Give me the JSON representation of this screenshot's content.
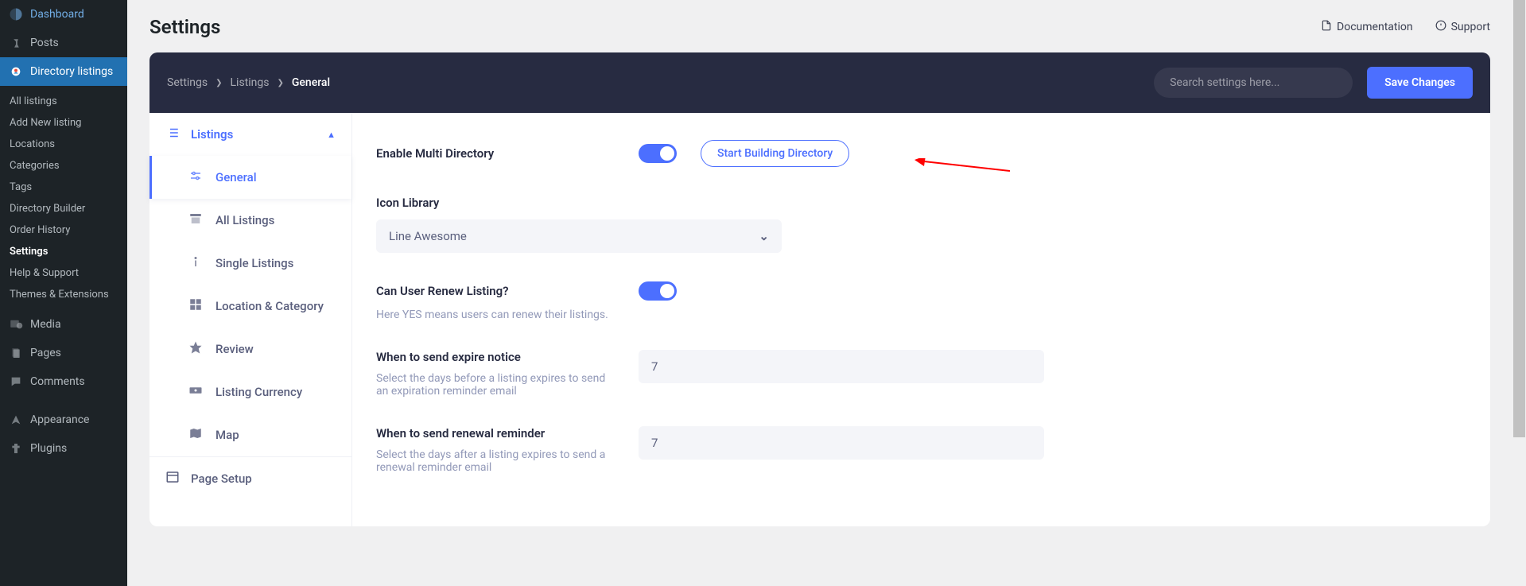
{
  "wp_sidebar": {
    "dashboard": "Dashboard",
    "posts": "Posts",
    "directory_listings": "Directory listings",
    "submenu": {
      "all_listings": "All listings",
      "add_new": "Add New listing",
      "locations": "Locations",
      "categories": "Categories",
      "tags": "Tags",
      "directory_builder": "Directory Builder",
      "order_history": "Order History",
      "settings": "Settings",
      "help_support": "Help & Support",
      "themes_ext": "Themes & Extensions"
    },
    "media": "Media",
    "pages": "Pages",
    "comments": "Comments",
    "appearance": "Appearance",
    "plugins": "Plugins"
  },
  "header": {
    "title": "Settings",
    "documentation": "Documentation",
    "support": "Support"
  },
  "topbar": {
    "crumb1": "Settings",
    "crumb2": "Listings",
    "crumb3": "General",
    "search_placeholder": "Search settings here...",
    "save_label": "Save Changes"
  },
  "nav": {
    "listings": "Listings",
    "general": "General",
    "all_listings": "All Listings",
    "single_listings": "Single Listings",
    "location_category": "Location & Category",
    "review": "Review",
    "listing_currency": "Listing Currency",
    "map": "Map",
    "page_setup": "Page Setup"
  },
  "fields": {
    "enable_multi": {
      "label": "Enable Multi Directory",
      "button": "Start Building Directory"
    },
    "icon_library": {
      "label": "Icon Library",
      "value": "Line Awesome"
    },
    "renew": {
      "label": "Can User Renew Listing?",
      "help": "Here YES means users can renew their listings."
    },
    "expire_notice": {
      "label": "When to send expire notice",
      "help": "Select the days before a listing expires to send an expiration reminder email",
      "value": "7"
    },
    "renewal_reminder": {
      "label": "When to send renewal reminder",
      "help": "Select the days after a listing expires to send a renewal reminder email",
      "value": "7"
    }
  }
}
